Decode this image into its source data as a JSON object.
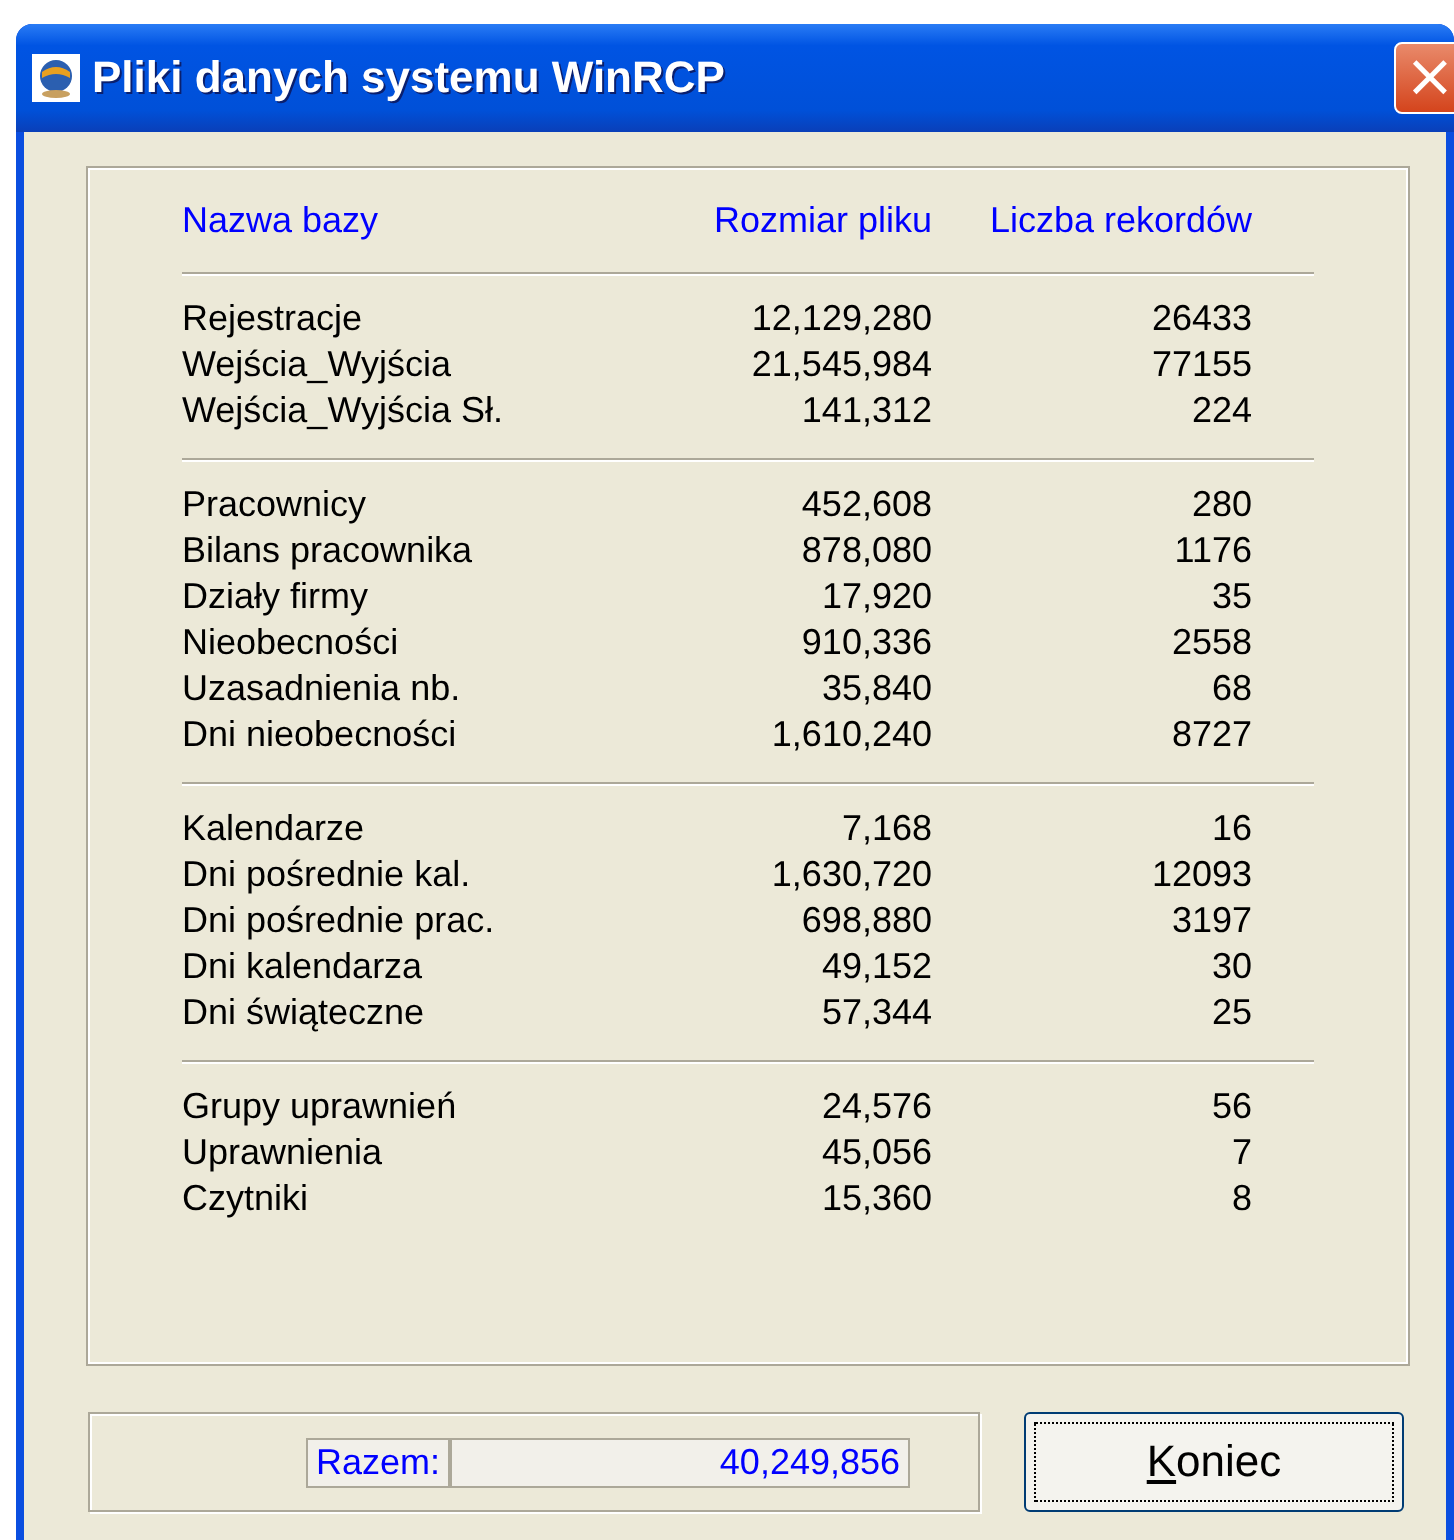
{
  "window": {
    "title": "Pliki danych systemu WinRCP",
    "close": "×"
  },
  "table": {
    "columns": [
      "Nazwa bazy",
      "Rozmiar pliku",
      "Liczba rekordów"
    ],
    "groups": [
      {
        "rows": [
          [
            "Rejestracje",
            "12,129,280",
            "26433"
          ],
          [
            "Wejścia_Wyjścia",
            "21,545,984",
            "77155"
          ],
          [
            "Wejścia_Wyjścia Sł.",
            "141,312",
            "224"
          ]
        ]
      },
      {
        "rows": [
          [
            "Pracownicy",
            "452,608",
            "280"
          ],
          [
            "Bilans pracownika",
            "878,080",
            "1176"
          ],
          [
            "Działy firmy",
            "17,920",
            "35"
          ],
          [
            "Nieobecności",
            "910,336",
            "2558"
          ],
          [
            "Uzasadnienia nb.",
            "35,840",
            "68"
          ],
          [
            "Dni nieobecności",
            "1,610,240",
            "8727"
          ]
        ]
      },
      {
        "rows": [
          [
            "Kalendarze",
            "7,168",
            "16"
          ],
          [
            "Dni pośrednie kal.",
            "1,630,720",
            "12093"
          ],
          [
            "Dni pośrednie prac.",
            "698,880",
            "3197"
          ],
          [
            "Dni kalendarza",
            "49,152",
            "30"
          ],
          [
            "Dni świąteczne",
            "57,344",
            "25"
          ]
        ]
      },
      {
        "rows": [
          [
            "Grupy uprawnień",
            "24,576",
            "56"
          ],
          [
            "Uprawnienia",
            "45,056",
            "7"
          ],
          [
            "Czytniki",
            "15,360",
            "8"
          ]
        ]
      }
    ]
  },
  "total": {
    "label": "Razem:",
    "value": "40,249,856"
  },
  "button": {
    "label": "Koniec"
  }
}
